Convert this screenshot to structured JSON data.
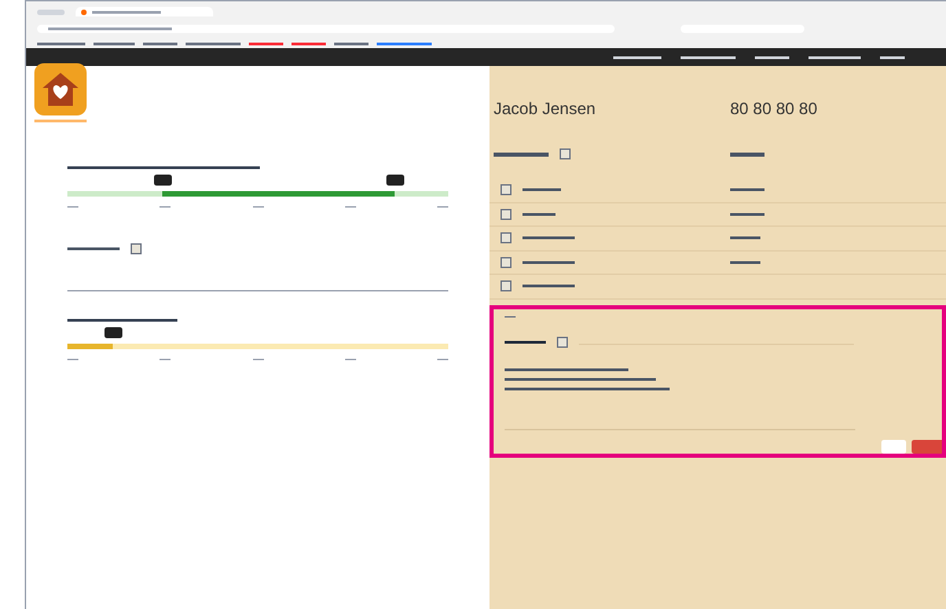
{
  "sliders": [
    {
      "kind": "range",
      "handles": [
        {
          "level": 0.25
        },
        {
          "level": 0.86
        }
      ]
    },
    {
      "kind": "single",
      "level": 0.12
    }
  ],
  "private_checkbox": {
    "checked": false
  },
  "contact": {
    "name": "Jacob Jensen",
    "phone": "80 80 80 80"
  },
  "header_checkbox": {
    "checked": false
  },
  "rows": [
    {
      "checked": false
    },
    {
      "checked": false
    },
    {
      "checked": false
    },
    {
      "checked": false
    },
    {
      "checked": false
    }
  ],
  "notes": {
    "checked": false,
    "highlighted": true
  }
}
